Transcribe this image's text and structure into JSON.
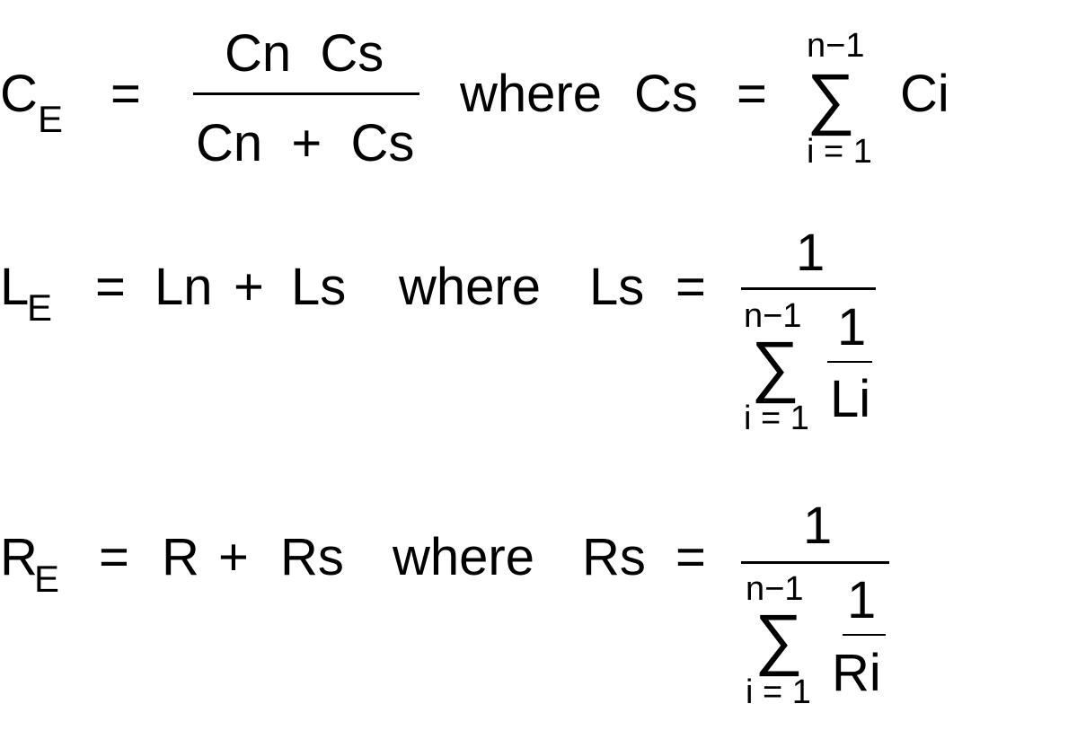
{
  "equations": [
    {
      "lhs": "C",
      "lhs_sub": "E",
      "eq": "=",
      "num": "Cn  Cs",
      "den": "Cn  +  Cs",
      "where": "where",
      "var": "Cs",
      "eq2": "=",
      "sum_upper": "n−1",
      "sum_symbol": "∑",
      "sum_lower": "i = 1",
      "summand": "Ci"
    },
    {
      "lhs": "L",
      "lhs_sub": "E",
      "eq": "=",
      "a": "Ln",
      "plus": "+",
      "b": "Ls",
      "where": "where",
      "var": "Ls",
      "eq2": "=",
      "num": "1",
      "sum_upper": "n−1",
      "sum_symbol": "∑",
      "sum_lower": "i = 1",
      "inner_num": "1",
      "inner_den": "Li"
    },
    {
      "lhs": "R",
      "lhs_sub": "E",
      "eq": "=",
      "a": "R",
      "plus": "+",
      "b": "Rs",
      "where": "where",
      "var": "Rs",
      "eq2": "=",
      "num": "1",
      "sum_upper": "n−1",
      "sum_symbol": "∑",
      "sum_lower": "i = 1",
      "inner_num": "1",
      "inner_den": "Ri"
    }
  ]
}
